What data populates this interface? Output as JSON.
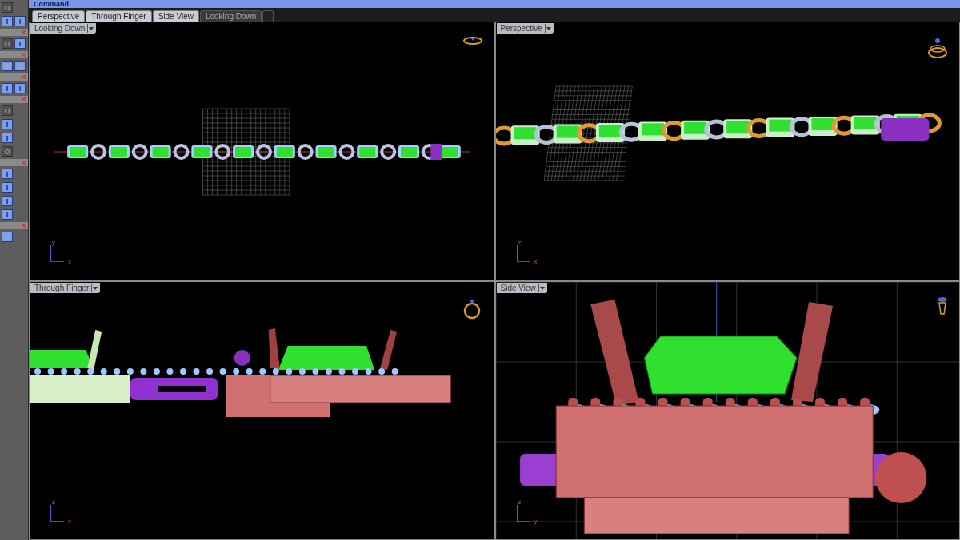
{
  "command_line": {
    "text": "Command:"
  },
  "viewport_tabs": [
    {
      "label": "Perspective",
      "selected": false
    },
    {
      "label": "Through Finger",
      "selected": false
    },
    {
      "label": "Side View",
      "selected": false
    },
    {
      "label": "Looking Down",
      "selected": true
    }
  ],
  "viewports": [
    {
      "title": "Looking Down",
      "kind": "top",
      "axes": [
        "y",
        "x"
      ]
    },
    {
      "title": "Perspective",
      "kind": "perspective",
      "axes": [
        "z",
        "x"
      ]
    },
    {
      "title": "Through Finger",
      "kind": "front",
      "axes": [
        "z",
        "x"
      ]
    },
    {
      "title": "Side View",
      "kind": "side",
      "axes": [
        "z",
        "y"
      ]
    }
  ]
}
